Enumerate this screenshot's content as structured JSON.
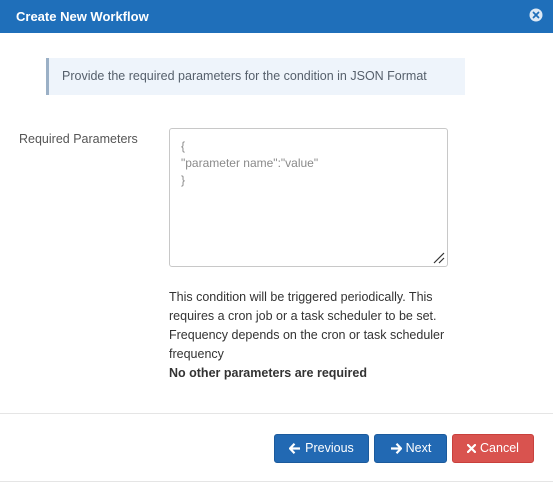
{
  "header": {
    "title": "Create New Workflow",
    "close_icon": "close-circle-icon"
  },
  "info": {
    "text": "Provide the required parameters for the condition in JSON Format"
  },
  "form": {
    "label": "Required Parameters",
    "textarea": {
      "value": "",
      "placeholder": "{\n\"parameter name\":\"value\"\n}"
    },
    "help": {
      "text": "This condition will be triggered periodically. This requires a cron job or a task scheduler to be set. Frequency depends on the cron or task scheduler frequency",
      "bold": "No other parameters are required"
    }
  },
  "footer": {
    "previous_label": "Previous",
    "next_label": "Next",
    "cancel_label": "Cancel",
    "previous_icon": "arrow-left-icon",
    "next_icon": "arrow-right-icon",
    "cancel_icon": "times-icon"
  },
  "colors": {
    "header_bg": "#1f6fba",
    "primary": "#2269b3",
    "danger": "#d9534f",
    "info_bg": "#eef4fb"
  }
}
